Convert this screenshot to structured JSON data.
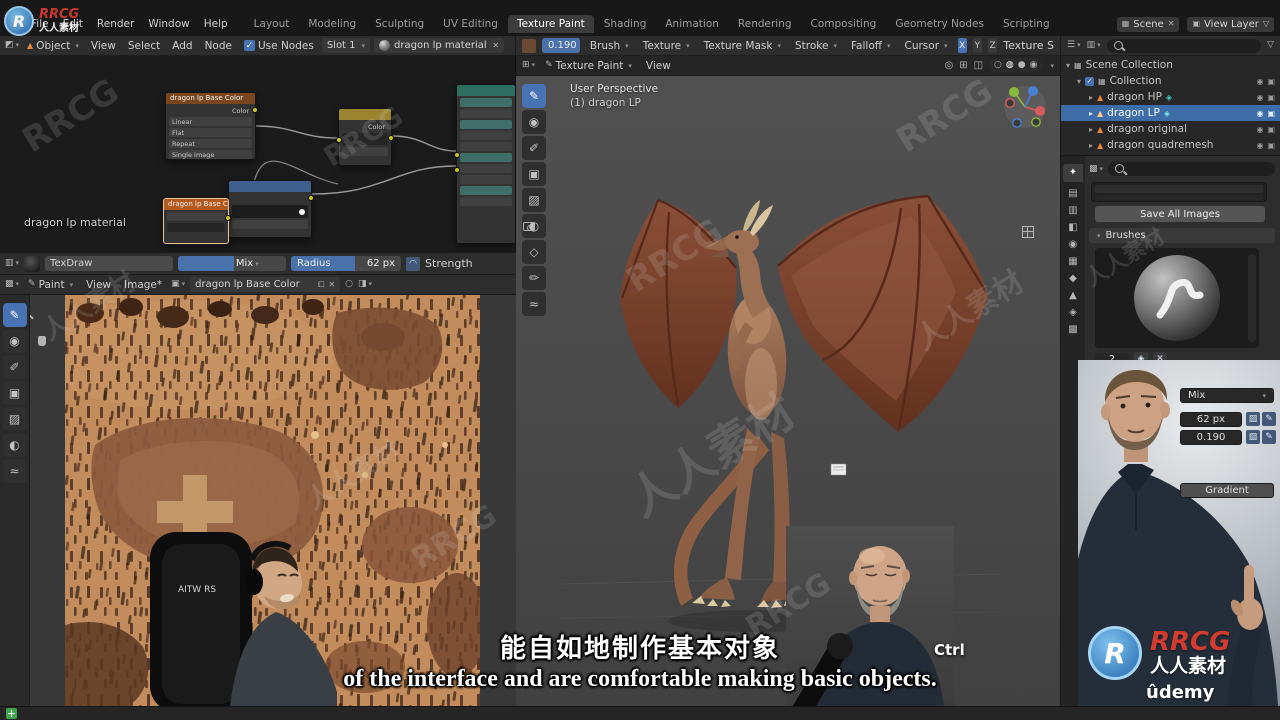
{
  "colors": {
    "accent_blue": "#4772b3",
    "selected_row_blue": "#3d6ca8",
    "brand_red": "#d23b2f",
    "brand_blue": "#2f7fc1",
    "canvas_tan": "#c28c5c",
    "dragon_body": "#9d7053",
    "dragon_wing": "#7c4530"
  },
  "brand": {
    "rrcg": "RRCG",
    "renren": "人人素材",
    "udemy": "ûdemy",
    "logo_letter": "R"
  },
  "icons": {
    "chevron_down": "▾",
    "chevron_right": "▸",
    "close": "✕",
    "check": "✓",
    "eye": "◉",
    "camera_toggle": "▣",
    "funnel": "▽",
    "collection": "▦",
    "object": "▲",
    "pin": "○",
    "viewport_tools": [
      "✎",
      "◉",
      "✐",
      "▣",
      "▨",
      "◐",
      "◇",
      "✏",
      "≈"
    ],
    "image_tools": [
      "✎",
      "◉",
      "✐",
      "▣",
      "▨",
      "◐",
      "≈"
    ],
    "props_tabs": [
      "✦",
      "▤",
      "▥",
      "◧",
      "◉",
      "▦",
      "◆",
      "▲",
      "◈",
      "▩"
    ],
    "shading": [
      "○",
      "◍",
      "●",
      "◉"
    ],
    "header_misc": [
      "◎",
      "⊞",
      "◫"
    ]
  },
  "topbar": {
    "menus": [
      "File",
      "Edit",
      "Render",
      "Window",
      "Help"
    ],
    "tabs": [
      "Layout",
      "Modeling",
      "Sculpting",
      "UV Editing",
      "Texture Paint",
      "Shading",
      "Animation",
      "Rendering",
      "Compositing",
      "Geometry Nodes",
      "Scripting"
    ],
    "scene_label": "Scene",
    "view_layer_label": "View Layer"
  },
  "node_header": {
    "mode": "Object",
    "menus": [
      "View",
      "Select",
      "Add",
      "Node"
    ],
    "use_nodes": "Use Nodes",
    "slot": "Slot 1",
    "material": "dragon lp material"
  },
  "tool_settings": {
    "strength": "0.190",
    "items": [
      "Brush",
      "Texture",
      "Texture Mask",
      "Stroke",
      "Falloff",
      "Cursor"
    ],
    "mirror": [
      "X",
      "Y",
      "Z"
    ],
    "texture_s": "Texture S"
  },
  "node_editor": {
    "material_label": "dragon lp material",
    "image_node": {
      "title": "dragon lp Base Color",
      "output": "Color",
      "rows": [
        "Linear",
        "Flat",
        "Repeat",
        "Single Image"
      ]
    },
    "mix_node_output": "Color"
  },
  "brush_bar": {
    "name": "TexDraw",
    "blend": "Mix",
    "radius_label": "Radius",
    "radius_value": "62 px",
    "strength_label": "Strength"
  },
  "image_editor": {
    "mode": "Paint",
    "menu_view": "View",
    "menu_image": "Image*",
    "image_name": "dragon lp Base Color"
  },
  "viewport": {
    "mode": "Texture Paint",
    "menu_view": "View",
    "overlay_line1": "User Perspective",
    "overlay_line2": "(1) dragon LP"
  },
  "outliner": {
    "scene_collection": "Scene Collection",
    "collection": "Collection",
    "items": [
      "dragon HP",
      "dragon LP",
      "dragon original",
      "dragon quadremesh"
    ]
  },
  "properties": {
    "save_button": "Save All Images",
    "panel_brushes": "Brushes",
    "brush_count": "2",
    "blend": "Mix",
    "radius": "62 px",
    "strength": "0.190",
    "gradient": "Gradient"
  },
  "webcam": {
    "chair_text": "AITW RS"
  },
  "overlay": {
    "key_hint": "Ctrl"
  },
  "subtitles": {
    "line1": "能自如地制作基本对象",
    "line2": "of the interface and are comfortable making basic objects."
  }
}
